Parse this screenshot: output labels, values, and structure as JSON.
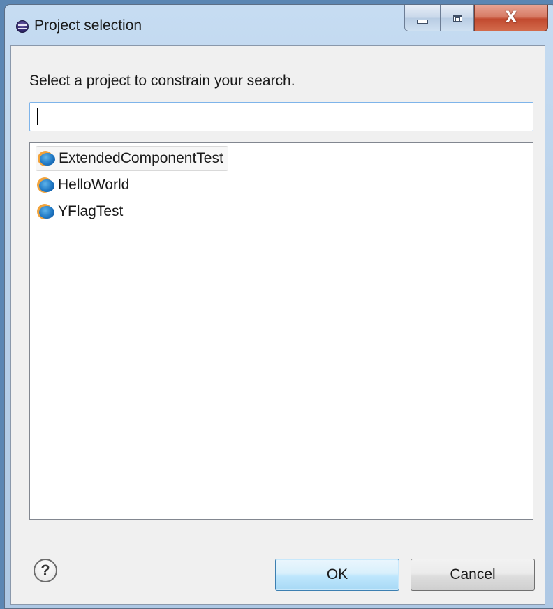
{
  "window": {
    "title": "Project selection",
    "app_icon": "eclipse-icon",
    "controls": {
      "minimize_icon": "minimize-icon",
      "maximize_icon": "maximize-icon",
      "close_label": "X"
    }
  },
  "dialog": {
    "prompt": "Select a project to constrain your search.",
    "search": {
      "value": "",
      "placeholder": ""
    },
    "projects": [
      {
        "label": "ExtendedComponentTest",
        "icon": "project-icon",
        "selected": true
      },
      {
        "label": "HelloWorld",
        "icon": "project-icon",
        "selected": false
      },
      {
        "label": "YFlagTest",
        "icon": "project-icon",
        "selected": false
      }
    ],
    "help_label": "?",
    "ok_label": "OK",
    "cancel_label": "Cancel"
  },
  "colors": {
    "accent": "#3c7fb1",
    "close_button": "#c24a2f",
    "client_bg": "#f0f0f0"
  }
}
